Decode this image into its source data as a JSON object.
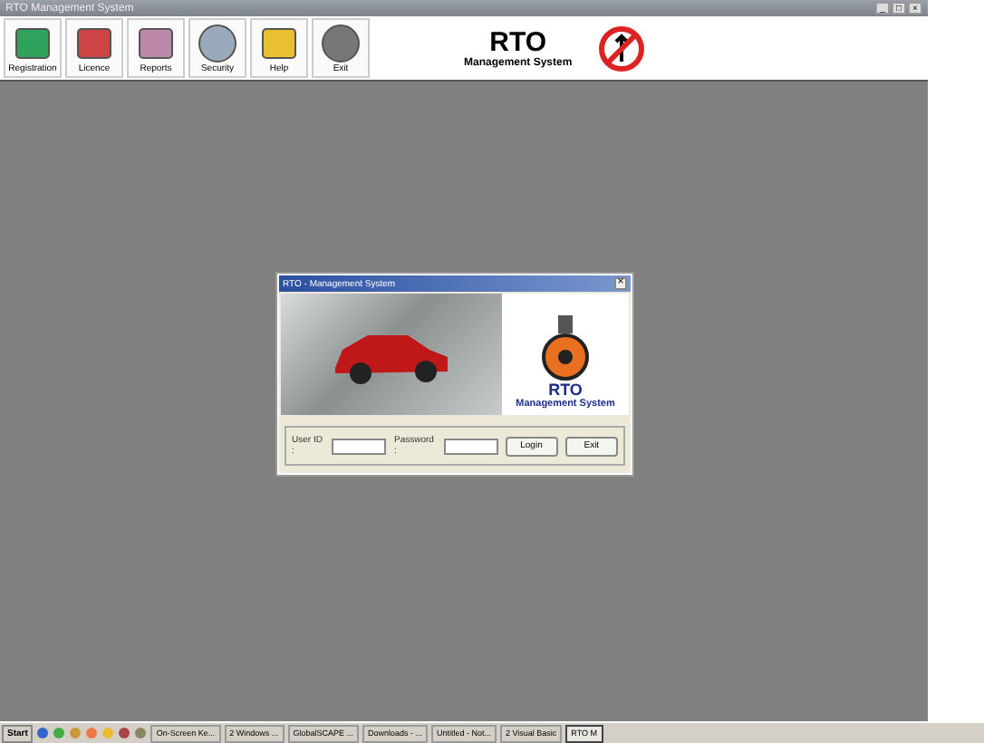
{
  "window": {
    "title": "RTO Management System",
    "controls": [
      "_",
      "□",
      "×"
    ]
  },
  "toolbar": [
    {
      "label": "Registration"
    },
    {
      "label": "Licence"
    },
    {
      "label": "Reports"
    },
    {
      "label": "Security"
    },
    {
      "label": "Help"
    },
    {
      "label": "Exit"
    }
  ],
  "brand": {
    "title": "RTO",
    "subtitle": "Management System"
  },
  "login_dialog": {
    "title": "RTO - Management System",
    "close": "×",
    "logo_title": "RTO",
    "logo_subtitle": "Management System",
    "user_id_label": "User ID :",
    "password_label": "Password :",
    "buttons": [
      "Login",
      "Exit"
    ]
  },
  "taskbar": {
    "start": "Start",
    "items": [
      {
        "label": "On-Screen Ke...",
        "selected": false
      },
      {
        "label": "2 Windows ...",
        "selected": false
      },
      {
        "label": "GlobalSCAPE ...",
        "selected": false
      },
      {
        "label": "Downloads - ...",
        "selected": false
      },
      {
        "label": "Untitled - Not...",
        "selected": false
      },
      {
        "label": "2 Visual Basic",
        "selected": false
      },
      {
        "label": "RTO M",
        "selected": true
      }
    ]
  }
}
